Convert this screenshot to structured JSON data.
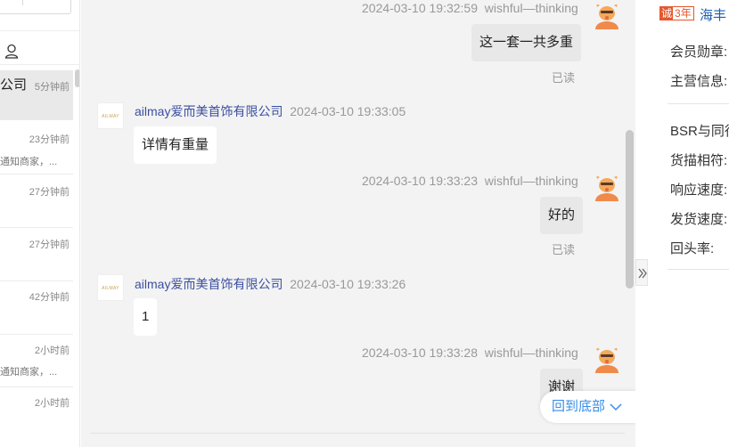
{
  "conversation_list": {
    "items": [
      {
        "name": "公司",
        "time": "5分钟前",
        "msg": "",
        "active": true
      },
      {
        "name": "",
        "time": "23分钟前",
        "msg": "通知商家，...",
        "active": false
      },
      {
        "name": "",
        "time": "27分钟前",
        "msg": "",
        "active": false
      },
      {
        "name": "",
        "time": "27分钟前",
        "msg": "",
        "active": false
      },
      {
        "name": "",
        "time": "42分钟前",
        "msg": "",
        "active": false
      },
      {
        "name": "",
        "time": "2小时前",
        "msg": "通知商家，...",
        "active": false
      },
      {
        "name": "",
        "time": "2小时前",
        "msg": "",
        "active": false
      }
    ]
  },
  "chat": {
    "messages": [
      {
        "direction": "out",
        "time": "2024-03-10 19:32:59",
        "sender": "wishful—thinking",
        "text": "这一套一共多重",
        "status": "已读"
      },
      {
        "direction": "in",
        "time": "2024-03-10 19:33:05",
        "sender": "ailmay爱而美首饰有限公司",
        "text": "详情有重量",
        "avatar_text": "AILMAY"
      },
      {
        "direction": "out",
        "time": "2024-03-10 19:33:23",
        "sender": "wishful—thinking",
        "text": "好的",
        "status": "已读"
      },
      {
        "direction": "in",
        "time": "2024-03-10 19:33:26",
        "sender": "ailmay爱而美首饰有限公司",
        "text": "1",
        "avatar_text": "AILMAY"
      },
      {
        "direction": "out",
        "time": "2024-03-10 19:33:28",
        "sender": "wishful—thinking",
        "text": "谢谢",
        "status": ""
      }
    ],
    "back_to_bottom": "回到底部"
  },
  "right_panel": {
    "badge_cheng": "诚",
    "badge_years": "3年",
    "shop_name_partial": "海丰",
    "labels": [
      "会员勋章:",
      "主营信息:",
      "BSR与同行",
      "货描相符:",
      "响应速度:",
      "发货速度:",
      "回头率:"
    ]
  },
  "colors": {
    "accent_blue": "#3a8ee6",
    "shop_name": "#3b4fa0",
    "badge_red": "#e4572e",
    "avatar_orange": "#f08a4b"
  }
}
